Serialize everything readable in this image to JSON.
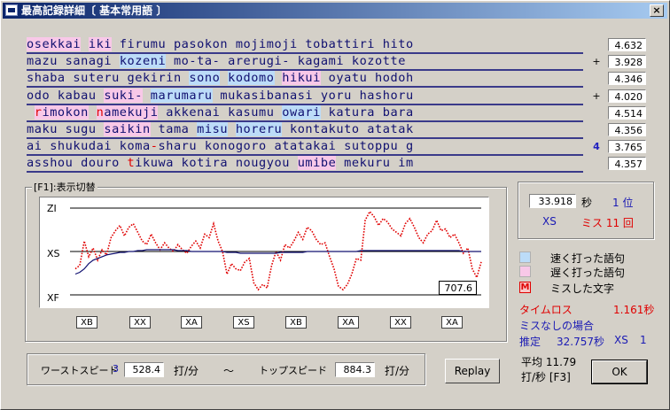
{
  "window": {
    "title": "最高記録詳細〔 基本常用語 〕",
    "close_glyph": "×"
  },
  "lines": [
    {
      "segs": [
        {
          "t": "osekkai",
          "c": "slow"
        },
        {
          "t": " "
        },
        {
          "t": "iki",
          "c": "slow"
        },
        {
          "t": " firumu pasokon mojimoji tobattiri hito"
        }
      ],
      "mark": "",
      "score": "4.632"
    },
    {
      "segs": [
        {
          "t": "mazu sanagi "
        },
        {
          "t": "kozeni",
          "c": "fast"
        },
        {
          "t": " mo-ta- arerugi- kagami kozotte "
        }
      ],
      "mark": "+",
      "score": "3.928"
    },
    {
      "segs": [
        {
          "t": "shaba suteru gekirin "
        },
        {
          "t": "sono",
          "c": "fast"
        },
        {
          "t": " "
        },
        {
          "t": "kodomo",
          "c": "fast"
        },
        {
          "t": " "
        },
        {
          "t": "hikui",
          "c": "slow"
        },
        {
          "t": " oyatu hodoh"
        }
      ],
      "mark": "",
      "score": "4.346"
    },
    {
      "segs": [
        {
          "t": "odo kabau "
        },
        {
          "t": "suki-",
          "c": "slow"
        },
        {
          "t": " "
        },
        {
          "t": "marumaru",
          "c": "fast"
        },
        {
          "t": " mukasibanasi yoru hashoru"
        }
      ],
      "mark": "+",
      "score": "4.020"
    },
    {
      "segs": [
        {
          "t": " "
        },
        {
          "t": "r",
          "c": "slow miss"
        },
        {
          "t": "imokon",
          "c": "slow"
        },
        {
          "t": " "
        },
        {
          "t": "n",
          "c": "slow miss"
        },
        {
          "t": "amekuji",
          "c": "slow"
        },
        {
          "t": " akkenai kasumu "
        },
        {
          "t": "owari",
          "c": "fast"
        },
        {
          "t": " katura bara"
        }
      ],
      "mark": "",
      "score": "4.514"
    },
    {
      "segs": [
        {
          "t": "maku sugu "
        },
        {
          "t": "saikin",
          "c": "slow"
        },
        {
          "t": " tama "
        },
        {
          "t": "misu",
          "c": "fast"
        },
        {
          "t": " "
        },
        {
          "t": "horeru",
          "c": "fast"
        },
        {
          "t": " kontakuto atatak"
        }
      ],
      "mark": "",
      "score": "4.356"
    },
    {
      "segs": [
        {
          "t": "ai shukudai koma"
        },
        {
          "t": "-",
          "c": "miss"
        },
        {
          "t": "sharu konogoro atatakai sutoppu g"
        }
      ],
      "mark": "4",
      "score": "3.765"
    },
    {
      "segs": [
        {
          "t": "asshou douro "
        },
        {
          "t": "t",
          "c": "miss"
        },
        {
          "t": "ikuwa kotira nougyou "
        },
        {
          "t": "umibe",
          "c": "slow"
        },
        {
          "t": " mekuru im"
        }
      ],
      "mark": "",
      "score": "4.357"
    }
  ],
  "chart": {
    "group_label": "[F1]:表示切替",
    "y_labels": {
      "top": "ZI",
      "mid": "XS",
      "bot": "XF"
    },
    "final_value": "707.6",
    "x_buttons": [
      "XB",
      "XX",
      "XA",
      "XS",
      "XB",
      "XA",
      "XX",
      "XA"
    ],
    "chart_data": {
      "type": "line",
      "y_categories": [
        "XF",
        "XS",
        "ZI"
      ],
      "series": [
        {
          "color": "#e00000",
          "style": "dotted",
          "values": [
            0.3,
            0.34,
            0.62,
            0.44,
            0.54,
            0.4,
            0.52,
            0.46,
            0.66,
            0.74,
            0.8,
            0.68,
            0.78,
            0.82,
            0.72,
            0.62,
            0.58,
            0.7,
            0.6,
            0.52,
            0.6,
            0.54,
            0.5,
            0.58,
            0.52,
            0.48,
            0.56,
            0.62,
            0.54,
            0.7,
            0.66,
            0.82,
            0.62,
            0.5,
            0.24,
            0.36,
            0.3,
            0.28,
            0.38,
            0.42,
            0.14,
            0.06,
            0.12,
            0.08,
            0.34,
            0.5,
            0.4,
            0.58,
            0.54,
            0.62,
            0.72,
            0.64,
            0.78,
            0.74,
            0.64,
            0.58,
            0.6,
            0.44,
            0.3,
            0.1,
            0.06,
            0.12,
            0.24,
            0.42,
            0.4,
            0.86,
            0.96,
            0.9,
            0.8,
            0.88,
            0.84,
            0.76,
            0.72,
            0.68,
            0.82,
            0.88,
            0.78,
            0.66,
            0.6,
            0.7,
            0.74,
            0.86,
            0.74,
            0.76,
            0.66,
            0.7,
            0.6,
            0.48,
            0.54,
            0.3,
            0.2,
            0.38
          ]
        },
        {
          "color": "#101070",
          "style": "solid",
          "values": [
            0.24,
            0.26,
            0.3,
            0.36,
            0.4,
            0.42,
            0.44,
            0.46,
            0.47,
            0.48,
            0.49,
            0.49,
            0.5,
            0.5,
            0.51,
            0.51,
            0.52,
            0.52,
            0.52,
            0.52,
            0.52,
            0.52,
            0.52,
            0.51,
            0.51,
            0.51,
            0.5,
            0.5,
            0.5,
            0.5,
            0.5,
            0.5,
            0.5,
            0.5,
            0.49,
            0.49,
            0.49,
            0.48,
            0.48,
            0.48,
            0.48,
            0.48,
            0.48,
            0.48,
            0.48,
            0.48,
            0.49,
            0.49,
            0.49,
            0.49,
            0.49,
            0.49,
            0.5,
            0.5,
            0.5,
            0.5,
            0.5,
            0.5,
            0.5,
            0.5,
            0.5,
            0.5,
            0.5,
            0.5,
            0.51,
            0.51,
            0.51,
            0.51,
            0.51,
            0.51,
            0.51,
            0.51,
            0.51,
            0.51,
            0.51,
            0.51,
            0.51,
            0.51,
            0.51,
            0.51,
            0.51,
            0.51,
            0.51,
            0.51,
            0.51,
            0.51,
            0.51,
            0.5,
            0.5,
            0.5,
            0.5,
            0.5
          ]
        }
      ]
    }
  },
  "result": {
    "time": "33.918",
    "sec_label": "秒",
    "rank": "1 位",
    "rank_letter": "XS",
    "miss_label": "ミス 11 回"
  },
  "legend": {
    "fast_label": "速く打った語句",
    "slow_label": "遅く打った語句",
    "miss_mark": "M",
    "miss_label": "ミスした文字",
    "colors": {
      "fast": "#bcdcf8",
      "slow": "#f8c8e8",
      "miss": "#e00000"
    }
  },
  "timeloss": {
    "label": "タイムロス",
    "value": "1.161秒"
  },
  "nomiss": {
    "label": "ミスなしの場合",
    "estimate_label": "推定",
    "estimate_value": "32.757秒",
    "estimate_rank": "XS",
    "estimate_num": "1"
  },
  "speed": {
    "worst_label": "ワーストスピード",
    "worst_num": "3",
    "worst_value": "528.4",
    "worst_unit": "打/分",
    "tilde": "～",
    "top_label": "トップスピード",
    "top_value": "884.3",
    "top_unit": "打/分"
  },
  "replay_label": "Replay",
  "average": {
    "line1": "平均 11.79",
    "line2": "打/秒 [F3]"
  },
  "ok_label": "OK"
}
